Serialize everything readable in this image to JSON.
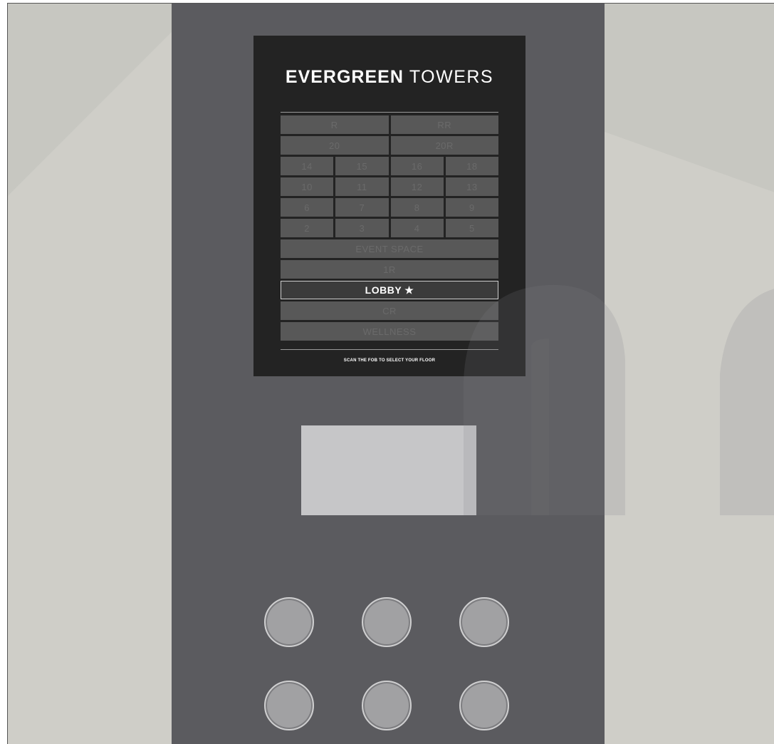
{
  "brand": {
    "bold": "EVERGREEN",
    "light": "TOWERS"
  },
  "floors": [
    [
      "R",
      "RR"
    ],
    [
      "20",
      "20R"
    ],
    [
      "14",
      "15",
      "16",
      "18"
    ],
    [
      "10",
      "11",
      "12",
      "13"
    ],
    [
      "6",
      "7",
      "8",
      "9"
    ],
    [
      "2",
      "3",
      "4",
      "5"
    ],
    [
      "EVENT SPACE"
    ],
    [
      "1R"
    ],
    [
      "LOBBY ★"
    ],
    [
      "CR"
    ],
    [
      "WELLNESS"
    ]
  ],
  "selected_floor": "LOBBY ★",
  "instruction": "SCAN THE FOB TO SELECT YOUR FLOOR",
  "keypad": {
    "rows": 2,
    "cols": 3
  },
  "colors": {
    "panel": "#5b5b5f",
    "screen": "#232323",
    "wall": "#cfcec8",
    "key": "#a1a1a3"
  }
}
